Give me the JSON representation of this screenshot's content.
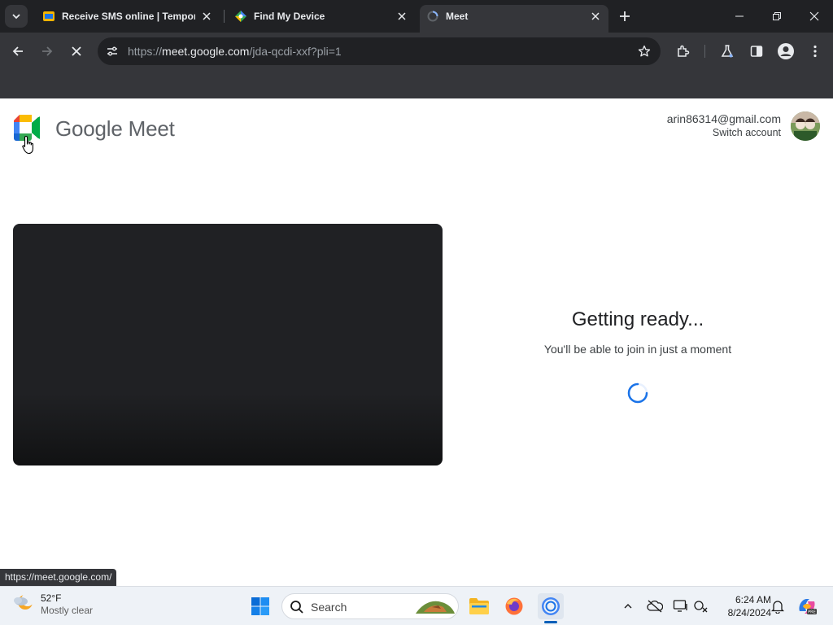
{
  "browser": {
    "tabs": [
      {
        "title": "Receive SMS online | Temporar",
        "icon": "sms-site-favicon",
        "active": false
      },
      {
        "title": "Find My Device",
        "icon": "find-my-device-favicon",
        "active": false
      },
      {
        "title": "Meet",
        "icon": "loading-favicon",
        "active": true
      }
    ],
    "url_prefix": "https://",
    "url_host": "meet.google.com",
    "url_path": "/jda-qcdi-xxf?pli=1",
    "status_url": "https://meet.google.com/"
  },
  "meet": {
    "brand": "Google Meet",
    "account_email": "arin86314@gmail.com",
    "switch_account": "Switch account",
    "heading": "Getting ready...",
    "subtext": "You'll be able to join in just a moment"
  },
  "taskbar": {
    "temperature": "52°F",
    "condition": "Mostly clear",
    "search_placeholder": "Search",
    "time": "6:24 AM",
    "date": "8/24/2024"
  },
  "colors": {
    "chrome_dark": "#202124",
    "chrome_toolbar": "#35363a",
    "accent_blue": "#1a73e8",
    "taskbar_bg": "#eef2f7"
  }
}
